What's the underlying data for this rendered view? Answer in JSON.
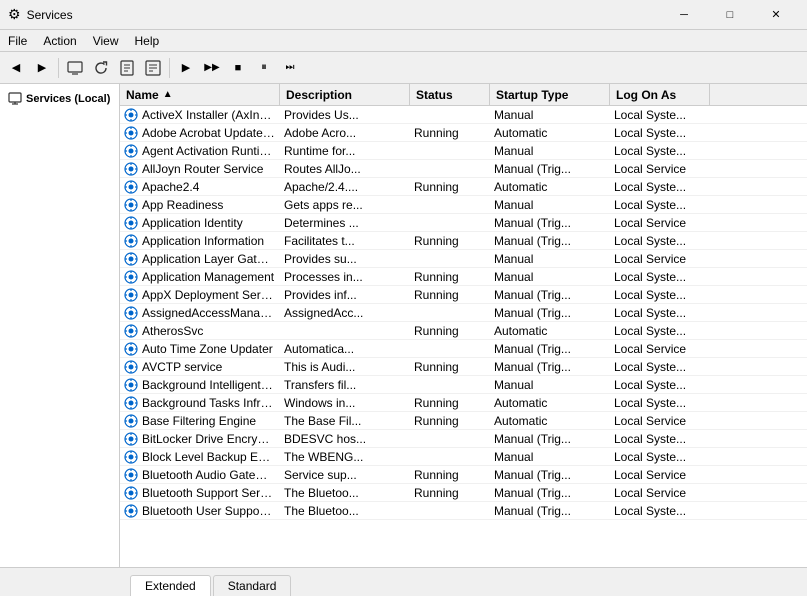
{
  "window": {
    "title": "Services",
    "icon": "⚙"
  },
  "titlebar": {
    "minimize": "─",
    "maximize": "□",
    "close": "✕"
  },
  "menu": {
    "items": [
      "File",
      "Action",
      "View",
      "Help"
    ]
  },
  "toolbar": {
    "buttons": [
      "←",
      "→",
      "📋",
      "🔄",
      "🔍",
      "🖥",
      "📄",
      "📃",
      "▶",
      "▶▶",
      "⏹",
      "⏸",
      "⏭"
    ]
  },
  "leftpanel": {
    "title": "Services (Local)"
  },
  "columns": {
    "headers": [
      "Name",
      "Description",
      "Status",
      "Startup Type",
      "Log On As"
    ]
  },
  "services": [
    {
      "name": "ActiveX Installer (AxInstSV)",
      "description": "Provides Us...",
      "status": "",
      "startup": "Manual",
      "logon": "Local Syste..."
    },
    {
      "name": "Adobe Acrobat Update Serv...",
      "description": "Adobe Acro...",
      "status": "Running",
      "startup": "Automatic",
      "logon": "Local Syste..."
    },
    {
      "name": "Agent Activation Runtime_...",
      "description": "Runtime for...",
      "status": "",
      "startup": "Manual",
      "logon": "Local Syste..."
    },
    {
      "name": "AllJoyn Router Service",
      "description": "Routes AllJo...",
      "status": "",
      "startup": "Manual (Trig...",
      "logon": "Local Service"
    },
    {
      "name": "Apache2.4",
      "description": "Apache/2.4....",
      "status": "Running",
      "startup": "Automatic",
      "logon": "Local Syste..."
    },
    {
      "name": "App Readiness",
      "description": "Gets apps re...",
      "status": "",
      "startup": "Manual",
      "logon": "Local Syste..."
    },
    {
      "name": "Application Identity",
      "description": "Determines ...",
      "status": "",
      "startup": "Manual (Trig...",
      "logon": "Local Service"
    },
    {
      "name": "Application Information",
      "description": "Facilitates t...",
      "status": "Running",
      "startup": "Manual (Trig...",
      "logon": "Local Syste..."
    },
    {
      "name": "Application Layer Gateway ...",
      "description": "Provides su...",
      "status": "",
      "startup": "Manual",
      "logon": "Local Service"
    },
    {
      "name": "Application Management",
      "description": "Processes in...",
      "status": "Running",
      "startup": "Manual",
      "logon": "Local Syste..."
    },
    {
      "name": "AppX Deployment Service (...",
      "description": "Provides inf...",
      "status": "Running",
      "startup": "Manual (Trig...",
      "logon": "Local Syste..."
    },
    {
      "name": "AssignedAccessManager Se...",
      "description": "AssignedAcc...",
      "status": "",
      "startup": "Manual (Trig...",
      "logon": "Local Syste..."
    },
    {
      "name": "AtherosSvc",
      "description": "",
      "status": "Running",
      "startup": "Automatic",
      "logon": "Local Syste..."
    },
    {
      "name": "Auto Time Zone Updater",
      "description": "Automatica...",
      "status": "",
      "startup": "Manual (Trig...",
      "logon": "Local Service"
    },
    {
      "name": "AVCTP service",
      "description": "This is Audi...",
      "status": "Running",
      "startup": "Manual (Trig...",
      "logon": "Local Syste..."
    },
    {
      "name": "Background Intelligent Tran...",
      "description": "Transfers fil...",
      "status": "",
      "startup": "Manual",
      "logon": "Local Syste..."
    },
    {
      "name": "Background Tasks Infrastruc...",
      "description": "Windows in...",
      "status": "Running",
      "startup": "Automatic",
      "logon": "Local Syste..."
    },
    {
      "name": "Base Filtering Engine",
      "description": "The Base Fil...",
      "status": "Running",
      "startup": "Automatic",
      "logon": "Local Service"
    },
    {
      "name": "BitLocker Drive Encryption ...",
      "description": "BDESVC hos...",
      "status": "",
      "startup": "Manual (Trig...",
      "logon": "Local Syste..."
    },
    {
      "name": "Block Level Backup Engine ...",
      "description": "The WBENG...",
      "status": "",
      "startup": "Manual",
      "logon": "Local Syste..."
    },
    {
      "name": "Bluetooth Audio Gateway S...",
      "description": "Service sup...",
      "status": "Running",
      "startup": "Manual (Trig...",
      "logon": "Local Service"
    },
    {
      "name": "Bluetooth Support Service",
      "description": "The Bluetoo...",
      "status": "Running",
      "startup": "Manual (Trig...",
      "logon": "Local Service"
    },
    {
      "name": "Bluetooth User Support Ser...",
      "description": "The Bluetoo...",
      "status": "",
      "startup": "Manual (Trig...",
      "logon": "Local Syste..."
    }
  ],
  "tabs": [
    {
      "label": "Extended",
      "active": true
    },
    {
      "label": "Standard",
      "active": false
    }
  ]
}
